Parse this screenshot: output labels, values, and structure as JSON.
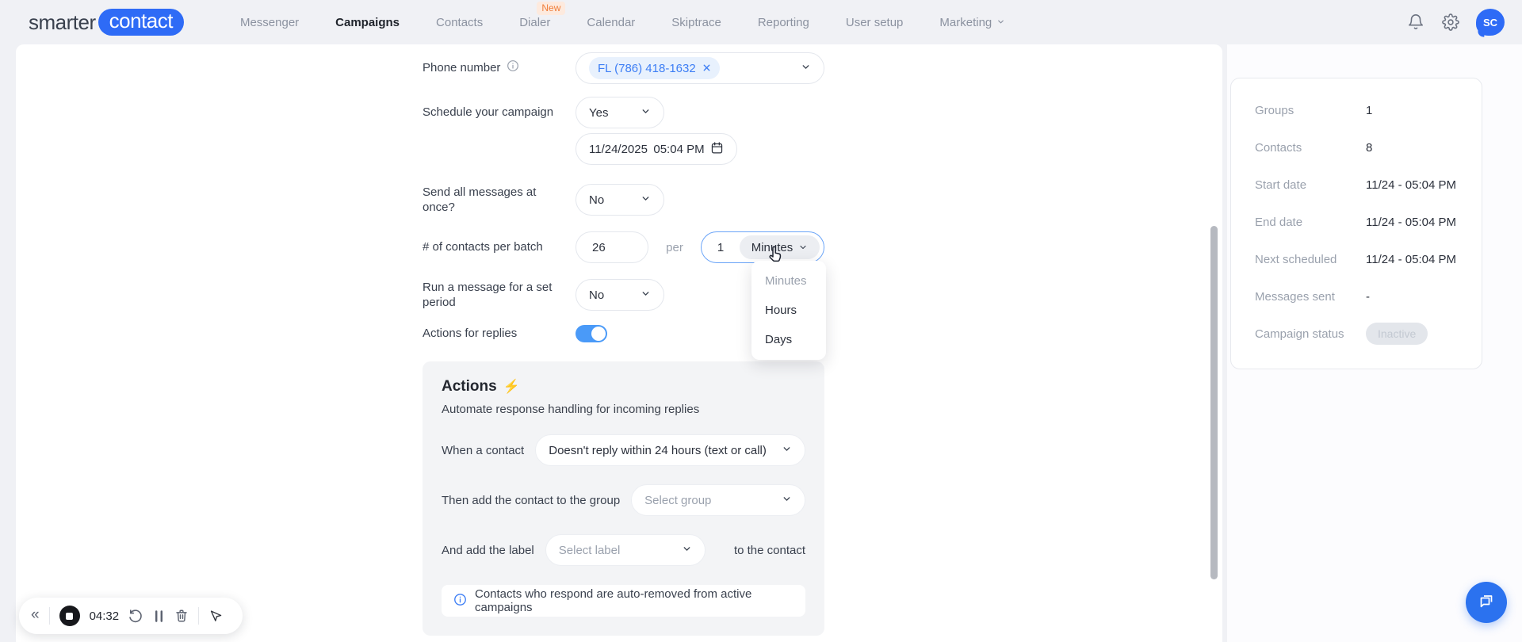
{
  "brand": {
    "word1": "smarter",
    "word2": "contact"
  },
  "nav": {
    "items": [
      {
        "label": "Messenger",
        "active": false
      },
      {
        "label": "Campaigns",
        "active": true
      },
      {
        "label": "Contacts",
        "active": false
      },
      {
        "label": "Dialer",
        "active": false,
        "badge": "New"
      },
      {
        "label": "Calendar",
        "active": false
      },
      {
        "label": "Skiptrace",
        "active": false
      },
      {
        "label": "Reporting",
        "active": false
      },
      {
        "label": "User setup",
        "active": false
      },
      {
        "label": "Marketing",
        "active": false,
        "has_dropdown": true
      }
    ]
  },
  "topbar": {
    "avatar_initials": "SC"
  },
  "form": {
    "phone": {
      "label": "Phone number",
      "selected_chip": "FL (786) 418-1632"
    },
    "schedule": {
      "label": "Schedule your campaign",
      "value": "Yes",
      "date": "11/24/2025",
      "time": "05:04 PM"
    },
    "send_all": {
      "label": "Send all messages at once?",
      "value": "No"
    },
    "batch": {
      "label": "# of contacts per batch",
      "count": "26",
      "per_label": "per",
      "interval": "1",
      "unit": "Minutes"
    },
    "unit_menu": {
      "options": [
        "Minutes",
        "Hours",
        "Days"
      ],
      "highlighted": "Minutes"
    },
    "run_period": {
      "label": "Run a message for a set period",
      "value": "No"
    },
    "replies_toggle": {
      "label": "Actions for replies",
      "state": "on"
    }
  },
  "actions": {
    "title": "Actions",
    "subtitle": "Automate response handling for incoming replies",
    "when": {
      "label": "When a contact",
      "value": "Doesn't reply within 24 hours (text or call)"
    },
    "group": {
      "label": "Then add the contact to the group",
      "placeholder": "Select group"
    },
    "label_action": {
      "label": "And add the label",
      "placeholder": "Select label",
      "suffix": "to the contact"
    },
    "note": "Contacts who respond are auto-removed from active campaigns"
  },
  "summary": {
    "rows": [
      {
        "label": "Groups",
        "value": "1"
      },
      {
        "label": "Contacts",
        "value": "8"
      },
      {
        "label": "Start date",
        "value": "11/24 - 05:04 PM"
      },
      {
        "label": "End date",
        "value": "11/24 - 05:04 PM"
      },
      {
        "label": "Next scheduled",
        "value": "11/24 - 05:04 PM"
      },
      {
        "label": "Messages sent",
        "value": "-"
      }
    ],
    "status": {
      "label": "Campaign status",
      "value": "Inactive"
    }
  },
  "recorder": {
    "time": "04:32"
  },
  "icons": {
    "bell-icon": "notification bell outline",
    "gear-icon": "settings gear outline",
    "chevron-down-icon": "dropdown chevron",
    "info-icon": "circled i",
    "calendar-icon": "calendar outline",
    "close-icon": "chip remove x",
    "lightning-icon": "⚡",
    "restart-icon": "circular arrow",
    "pause-icon": "double bars",
    "trash-icon": "trash can",
    "cursor-icon": "mouse pointer arrow",
    "chat-icon": "double speech bubbles",
    "hand-cursor": "pointing hand"
  },
  "colors": {
    "accent_blue": "#2e6bf6",
    "toggle_blue": "#4a9af8",
    "chip_bg": "#e8f1fd",
    "chip_text": "#3d7ef5",
    "new_badge_text": "#ef7d3a",
    "status_badge_bg": "#e3e6eb",
    "actions_panel_bg": "#f3f4f6"
  }
}
